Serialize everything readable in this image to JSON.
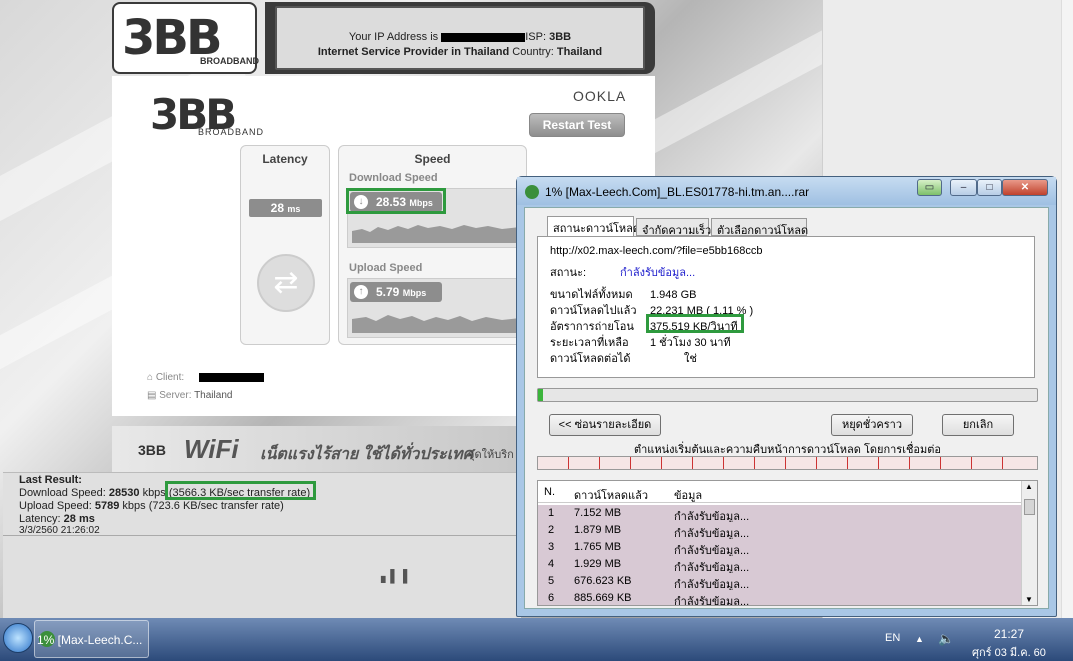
{
  "speedtest": {
    "brand": "3BB",
    "brand_sub": "BROADBAND",
    "ip_label": "Your IP Address is",
    "isp_label": "ISP:",
    "isp_value": "3BB",
    "provider_line": "Internet Service Provider in Thailand",
    "country_label": "Country:",
    "country_value": "Thailand",
    "ookla": "OOKLA",
    "restart_label": "Restart Test",
    "latency_title": "Latency",
    "latency_value": "28",
    "latency_unit": "ms",
    "speed_title": "Speed",
    "download_label": "Download Speed",
    "download_value": "28.53",
    "download_unit": "Mbps",
    "upload_label": "Upload Speed",
    "upload_value": "5.79",
    "upload_unit": "Mbps",
    "client_label": "Client:",
    "server_label": "Server:",
    "server_value": "Thailand",
    "wifi_prefix": "3BB",
    "wifi_word": "WiFi",
    "wifi_slogan": "เน็ตแรงไร้สาย ใช้ได้ทั่วประเทศ",
    "wifi_more": "จุดให้บริก"
  },
  "last_result": {
    "title": "Last Result:",
    "download_prefix": "Download Speed:",
    "download_kbps": "28530",
    "kbps": "kbps",
    "download_rate": "(3566.3 KB/sec transfer rate)",
    "upload_prefix": "Upload Speed:",
    "upload_kbps": "5789",
    "upload_rate": "(723.6 KB/sec transfer rate)",
    "latency_prefix": "Latency:",
    "latency_value": "28 ms",
    "date": "3/3/2560 21:26:02"
  },
  "idm": {
    "title": "1% [Max-Leech.Com]_BL.ES01778-hi.tm.an....rar",
    "tabs": [
      "สถานะดาวน์โหลด",
      "จำกัดความเร็ว",
      "ตัวเลือกดาวน์โหลด"
    ],
    "url": "http://x02.max-leech.com/?file=e5bb168ccb",
    "status_label": "สถานะ:",
    "status_value": "กำลังรับข้อมูล...",
    "size_label": "ขนาดไฟล์ทั้งหมด",
    "size_value": "1.948  GB",
    "downloaded_label": "ดาวน์โหลดไปแล้ว",
    "downloaded_value": "22.231  MB  ( 1.11 % )",
    "rate_label": "อัตราการถ่ายโอน",
    "rate_value": "375.519  KB/วินาที",
    "remaining_label": "ระยะเวลาที่เหลือ",
    "remaining_value": "1 ชั่วโมง 30 นาที",
    "resume_label": "ดาวน์โหลดต่อได้",
    "resume_value": "ใช่",
    "progress": 0.011,
    "details_button": "<< ซ่อนรายละเอียด",
    "pause_button": "หยุดชั่วคราว",
    "cancel_button": "ยกเลิก",
    "segments_title": "ตำแหน่งเริ่มต้นและความคืบหน้าการดาวน์โหลด โดยการเชื่อมต่อ",
    "columns": [
      "N.",
      "ดาวน์โหลดแล้ว",
      "ข้อมูล"
    ],
    "rows": [
      {
        "n": "1",
        "size": "7.152  MB",
        "info": "กำลังรับข้อมูล..."
      },
      {
        "n": "2",
        "size": "1.879  MB",
        "info": "กำลังรับข้อมูล..."
      },
      {
        "n": "3",
        "size": "1.765  MB",
        "info": "กำลังรับข้อมูล..."
      },
      {
        "n": "4",
        "size": "1.929  MB",
        "info": "กำลังรับข้อมูล..."
      },
      {
        "n": "5",
        "size": "676.623  KB",
        "info": "กำลังรับข้อมูล..."
      },
      {
        "n": "6",
        "size": "885.669  KB",
        "info": "กำลังรับข้อมูล..."
      }
    ]
  },
  "taskbar": {
    "item_label": "1% [Max-Leech.C...",
    "lang": "EN",
    "time": "21:27",
    "date": "ศุกร์ 03 มี.ค. 60"
  },
  "colors": {
    "highlight": "#2e9a3e",
    "progress": "#3bb43b"
  }
}
